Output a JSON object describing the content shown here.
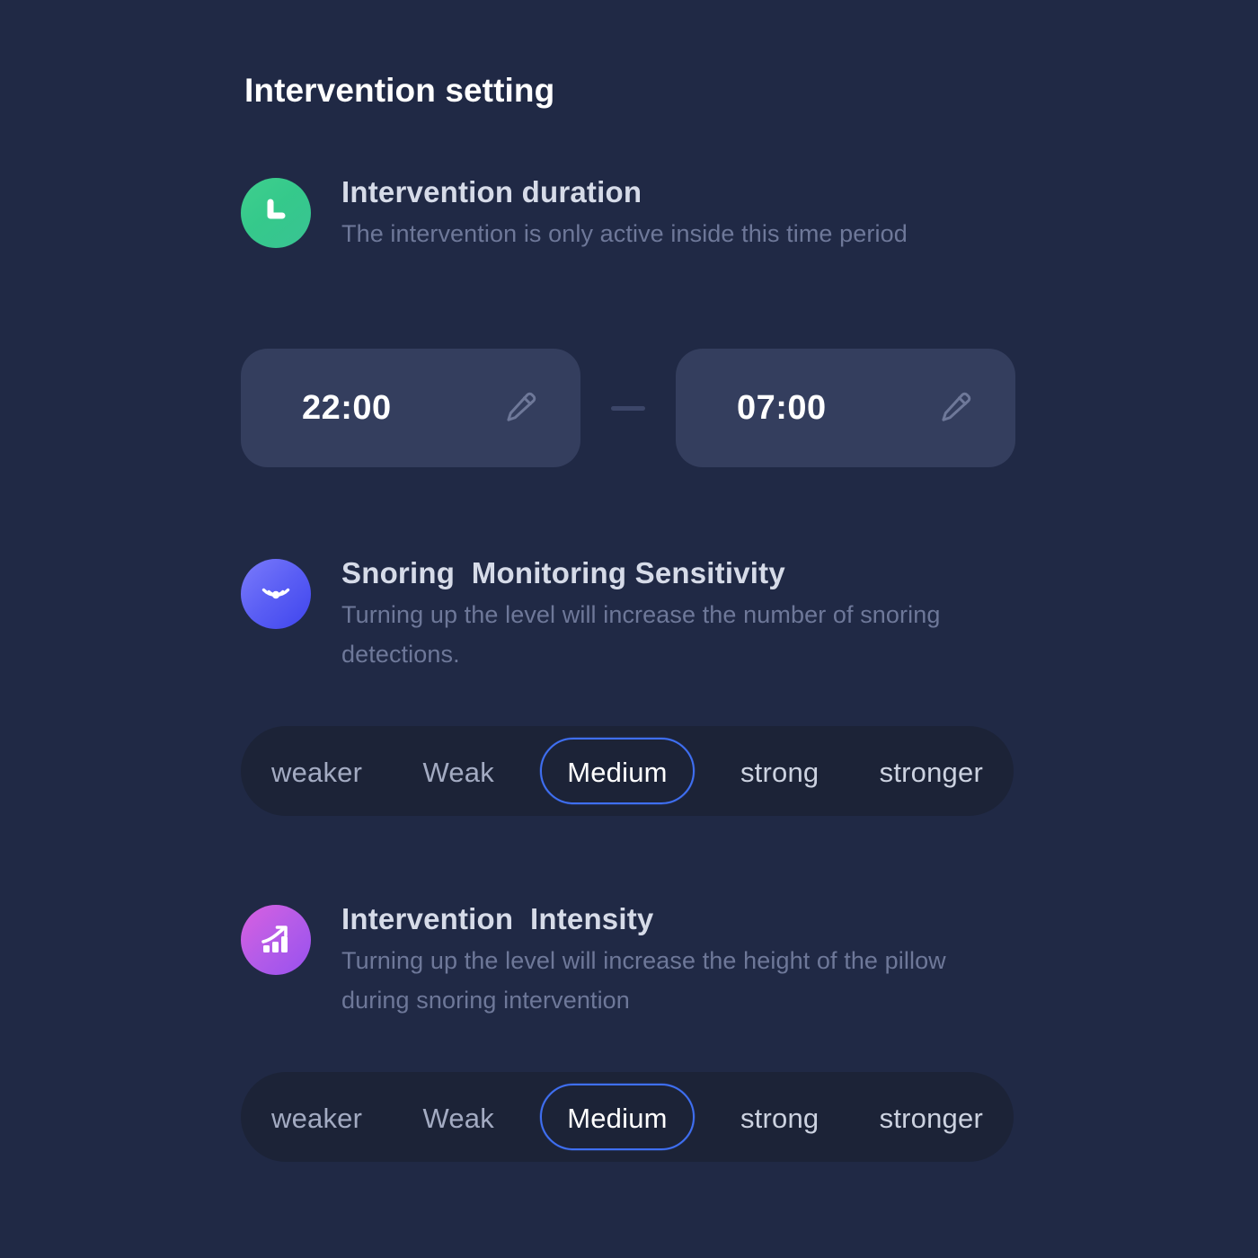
{
  "page": {
    "title": "Intervention setting",
    "background_color": "#202945",
    "accent_color": "#3f6ff2"
  },
  "sections": [
    {
      "id": "intervention-duration",
      "icon": "clock-icon",
      "icon_color": "#3fcf8e",
      "title": "Intervention duration",
      "description": "The intervention is only active inside this time period"
    },
    {
      "id": "snoring-monitoring-sensitivity",
      "icon": "sonar-icon",
      "icon_color": "#5a5ef4",
      "title": "Snoring  Monitoring Sensitivity",
      "description": "Turning up the level will increase the number of snoring detections."
    },
    {
      "id": "intervention-intensity",
      "icon": "growth-chart-icon",
      "icon_color": "#b45ce8",
      "title": "Intervention  Intensity",
      "description": "Turning up the level will increase the height of the pillow during snoring intervention"
    }
  ],
  "time_range": {
    "start_time": "22:00",
    "end_time": "07:00",
    "separator": "—",
    "edit_icon": "pencil-icon"
  },
  "sensitivity_levels": {
    "options": [
      "weaker",
      "Weak",
      "Medium",
      "strong",
      "stronger"
    ],
    "selected": "Medium"
  },
  "intensity_levels": {
    "options": [
      "weaker",
      "Weak",
      "Medium",
      "strong",
      "stronger"
    ],
    "selected": "Medium"
  }
}
